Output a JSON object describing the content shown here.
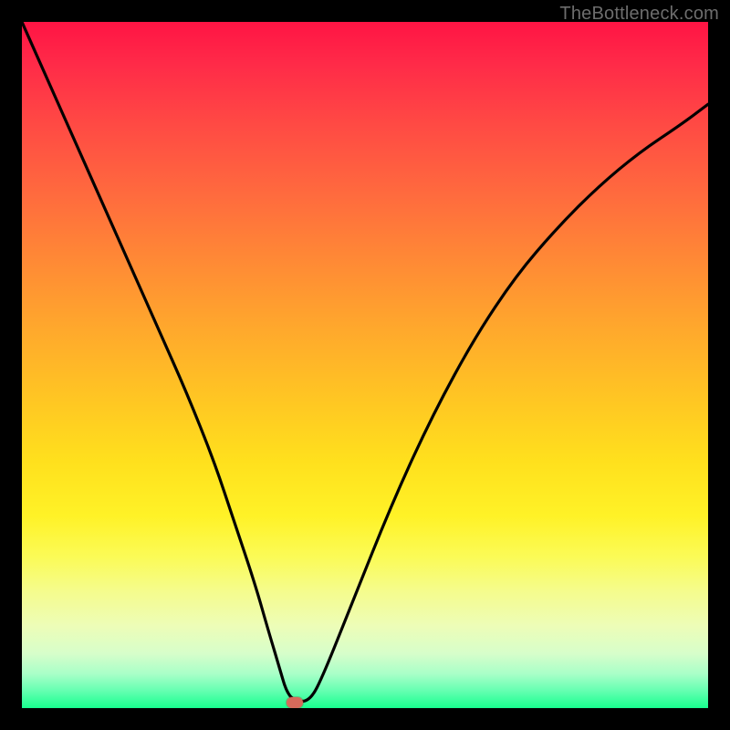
{
  "watermark": "TheBottleneck.com",
  "marker": {
    "x_frac": 0.397,
    "y_frac": 0.992
  },
  "chart_data": {
    "type": "line",
    "title": "",
    "xlabel": "",
    "ylabel": "",
    "xlim": [
      0,
      100
    ],
    "ylim": [
      0,
      100
    ],
    "grid": false,
    "legend": false,
    "annotations": [
      "TheBottleneck.com"
    ],
    "series": [
      {
        "name": "bottleneck-curve",
        "x": [
          0,
          4,
          8,
          12,
          16,
          20,
          24,
          28,
          31,
          34,
          36,
          37.5,
          38.5,
          39.7,
          42,
          44,
          48,
          54,
          60,
          66,
          72,
          78,
          84,
          90,
          96,
          100
        ],
        "y": [
          100,
          91,
          82,
          73,
          64,
          55,
          46,
          36,
          27,
          18,
          11,
          6,
          2.5,
          1,
          1,
          5,
          15,
          30,
          43,
          54,
          63,
          70,
          76,
          81,
          85,
          88
        ]
      }
    ],
    "background_gradient_stops": [
      {
        "pos": 0.0,
        "color": "#ff1444"
      },
      {
        "pos": 0.25,
        "color": "#ff6a3e"
      },
      {
        "pos": 0.55,
        "color": "#ffc623"
      },
      {
        "pos": 0.78,
        "color": "#f5fc8d"
      },
      {
        "pos": 1.0,
        "color": "#18ff8e"
      }
    ],
    "marker": {
      "x": 39.7,
      "y": 0.8,
      "color": "#d66a5b"
    }
  }
}
